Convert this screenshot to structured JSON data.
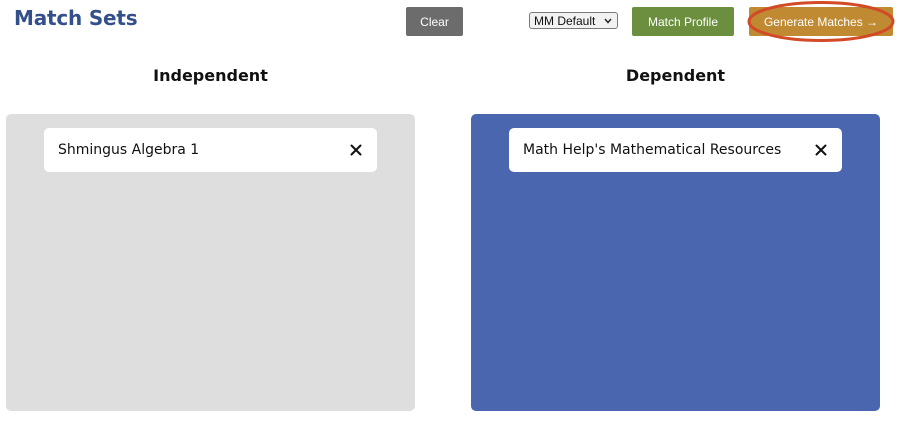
{
  "header": {
    "title": "Match Sets"
  },
  "toolbar": {
    "clear_label": "Clear",
    "profile_select_value": "MM Default",
    "match_profile_label": "Match Profile",
    "generate_label": "Generate Matches →"
  },
  "columns": {
    "independent": {
      "heading": "Independent",
      "items": [
        {
          "label": "Shmingus Algebra 1",
          "remove_icon": "close-icon"
        }
      ]
    },
    "dependent": {
      "heading": "Dependent",
      "items": [
        {
          "label": "Math Help's Mathematical Resources",
          "remove_icon": "close-icon"
        }
      ]
    }
  },
  "colors": {
    "title": "#34508c",
    "clear_button": "#6c6c6c",
    "match_profile_button": "#6b8f3e",
    "generate_button": "#c08a33",
    "highlight_ring": "#d24a26",
    "independent_panel": "#dedede",
    "dependent_panel": "#4966af"
  }
}
